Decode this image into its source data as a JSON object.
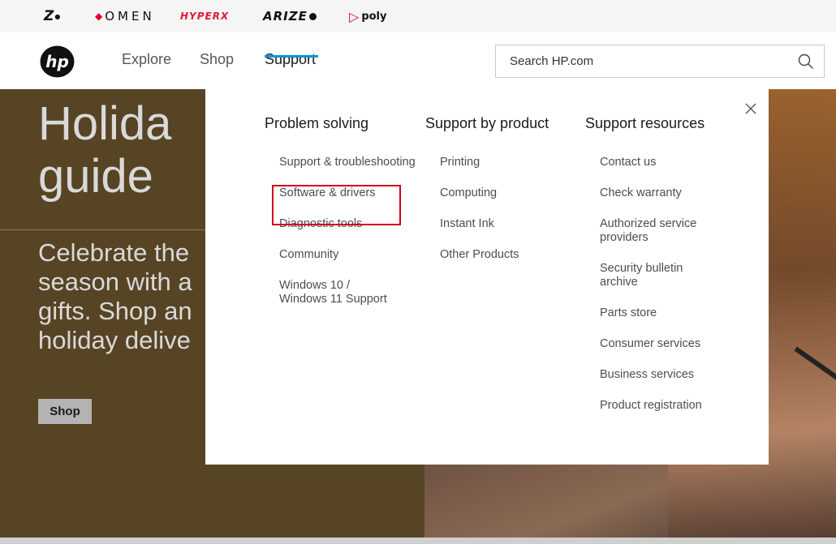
{
  "brands": {
    "z": "Z",
    "omen": "OMEN",
    "hyperx": "HYPERX",
    "arize": "ARIZE",
    "poly": "poly"
  },
  "nav": {
    "explore": "Explore",
    "shop": "Shop",
    "support": "Support"
  },
  "search": {
    "placeholder": "Search HP.com"
  },
  "hero": {
    "title_line1": "Holida",
    "title_line2": "guide",
    "subtitle_line1": "Celebrate the",
    "subtitle_line2": "season with a",
    "subtitle_line3": "gifts. Shop an",
    "subtitle_line4": "holiday delive",
    "button_label": "Shop"
  },
  "dropdown": {
    "problem_solving": {
      "title": "Problem solving",
      "items": [
        "Support & troubleshooting",
        "Software & drivers",
        "Diagnostic tools",
        "Community",
        "Windows 10 / Windows 11 Support"
      ]
    },
    "support_by_product": {
      "title": "Support by product",
      "items": [
        "Printing",
        "Computing",
        "Instant Ink",
        "Other Products"
      ]
    },
    "support_resources": {
      "title": "Support resources",
      "items": [
        "Contact us",
        "Check warranty",
        "Authorized service providers",
        "Security bulletin archive",
        "Parts store",
        "Consumer services",
        "Business services",
        "Product registration"
      ]
    }
  },
  "colors": {
    "accent": "#0096d6",
    "hero_bg": "#574424",
    "highlight": "#d0021b"
  }
}
